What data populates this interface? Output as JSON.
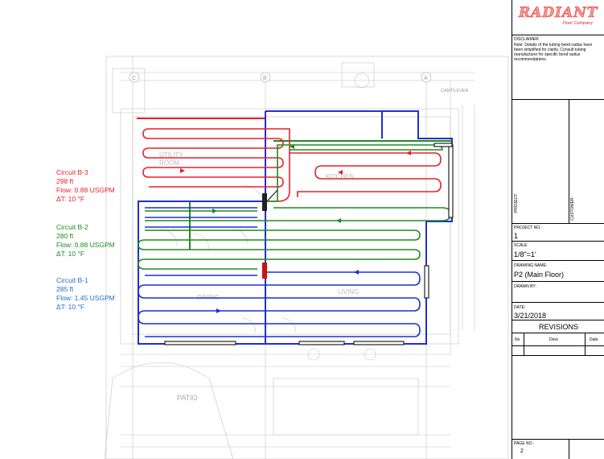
{
  "logo": {
    "name": "RADIANT",
    "sub": "Floor Company"
  },
  "disclaimer": {
    "label": "DISCLAIMER:",
    "lines": [
      "Note: Details of the tubing bend radius have",
      "been simplified for clarity. Consult tubing",
      "manufacturer for specific bend radius",
      "recommendations."
    ]
  },
  "side_labels": {
    "project": "PROJECT:",
    "customer": "CUSTOMER:"
  },
  "project_no": {
    "label": "PROJECT NO.:",
    "value": "1"
  },
  "scale": {
    "label": "SCALE:",
    "value": "1/8\"=1'"
  },
  "drawing_name": {
    "label": "DRAWING NAME:",
    "value": "P2 (Main Floor)"
  },
  "drawn_by": {
    "label": "DRAWN BY:",
    "value": ""
  },
  "date": {
    "label": "DATE:",
    "value": "3/21/2018"
  },
  "revisions": {
    "title": "REVISIONS",
    "cols": [
      "No",
      "Desc",
      "Date"
    ]
  },
  "page": {
    "label": "PAGE NO.:",
    "value": "2"
  },
  "circuits": [
    {
      "name": "Circuit B-3",
      "length": "298 ft",
      "flow": "Flow: 0.88 USGPM",
      "dt": "ΔT: 10 °F",
      "color": "#e8202a"
    },
    {
      "name": "Circuit B-2",
      "length": "280 ft",
      "flow": "Flow: 0.88 USGPM",
      "dt": "ΔT: 10 °F",
      "color": "#1f8a1f"
    },
    {
      "name": "Circuit B-1",
      "length": "285 ft",
      "flow": "Flow: 1.45 USGPM",
      "dt": "ΔT: 10 °F",
      "color": "#1e6fc9"
    }
  ],
  "plan_text": {
    "patio": "PATIO",
    "utility": "UTILITY",
    "room": "ROOM",
    "kitchen": "KITCHEN",
    "living": "LIVING",
    "dining": "DINING",
    "cantilever": "CANTILEVER",
    "grid_c": "C",
    "grid_b": "B",
    "grid_a": "A"
  },
  "colors": {
    "red": "#e8202a",
    "green": "#1f8a1f",
    "blue": "#1f2fd0",
    "manifold": "#222222",
    "plan": "#b8b8b8"
  }
}
